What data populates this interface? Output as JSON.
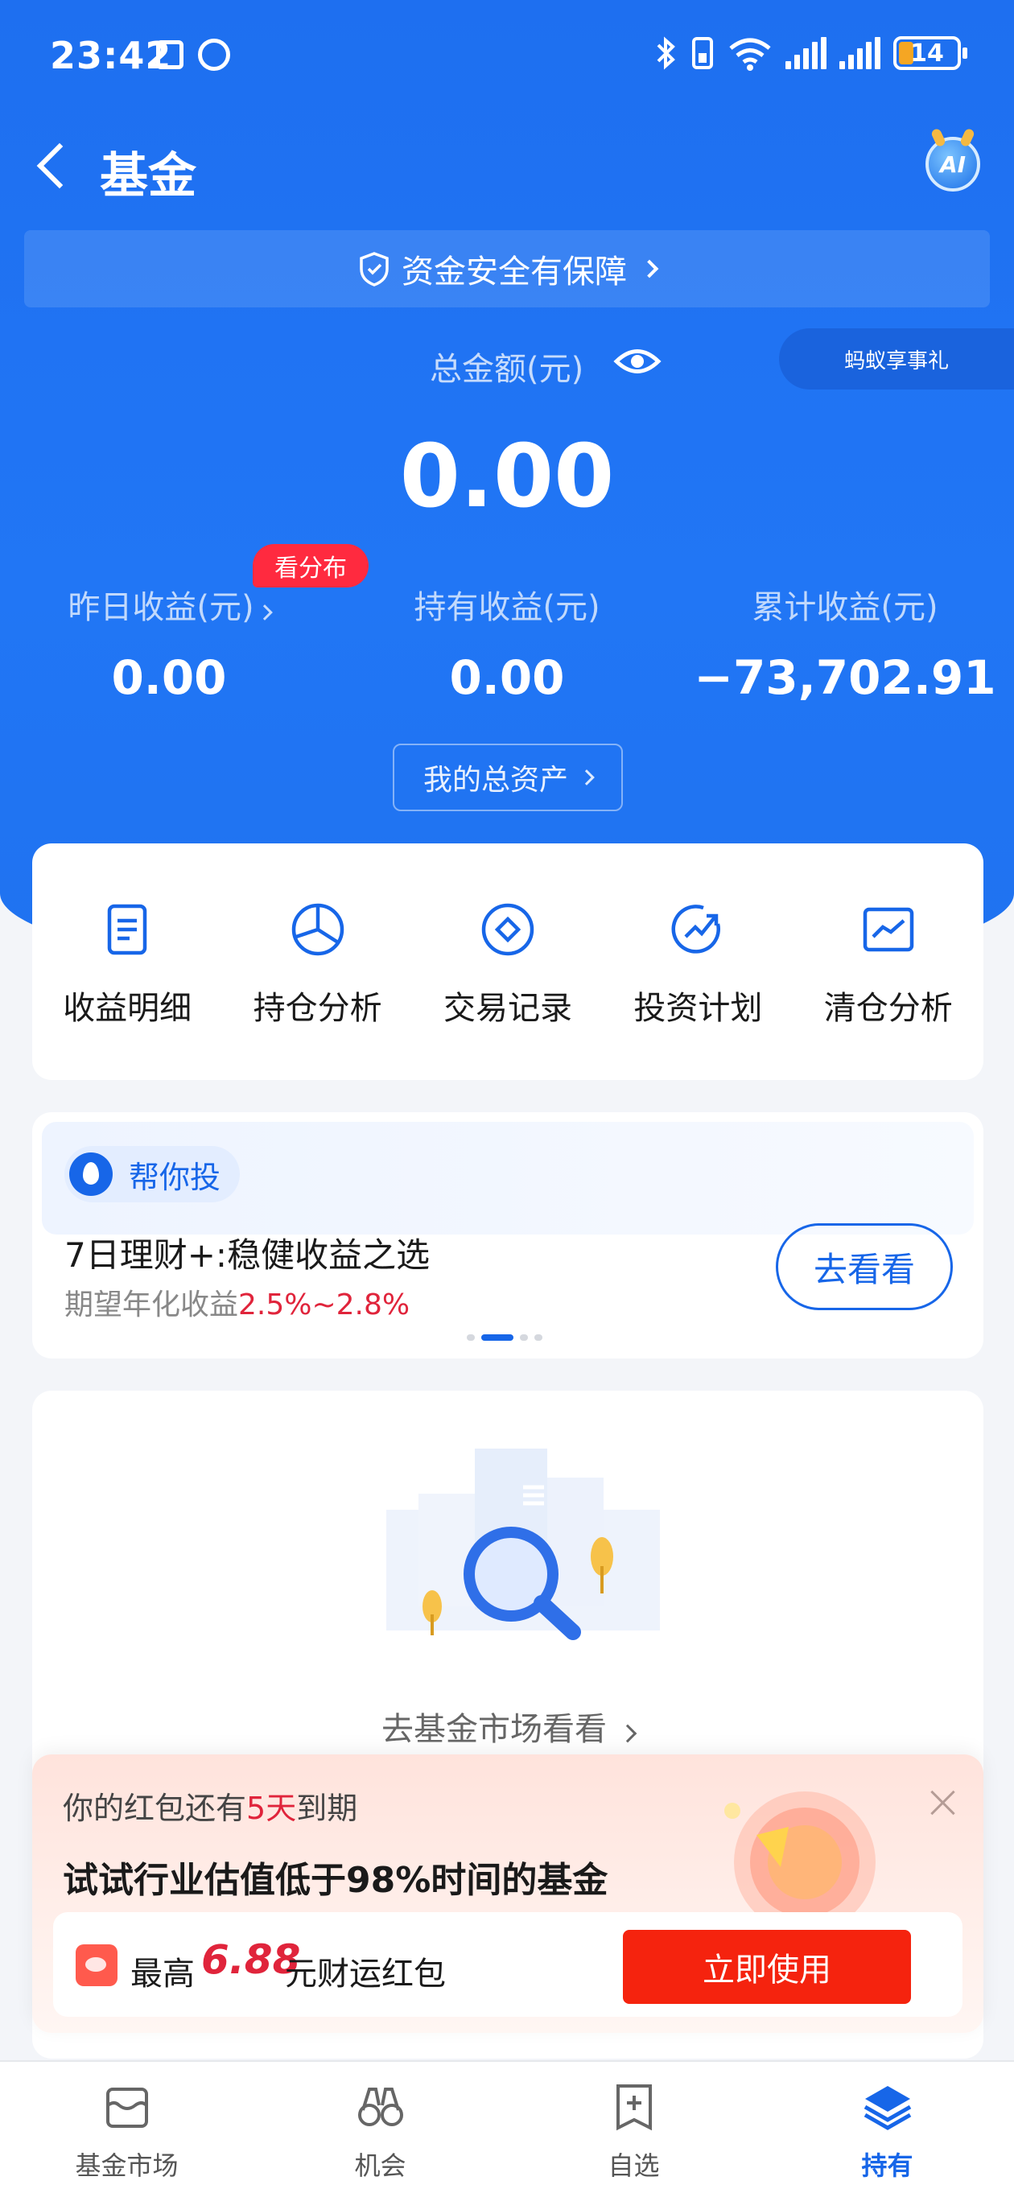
{
  "status_bar": {
    "time": "23:42",
    "battery": "14"
  },
  "header": {
    "title": "基金",
    "ai_label": "AI"
  },
  "safety_banner": {
    "text": "资金安全有保障"
  },
  "summary": {
    "total_label": "总金额(元)",
    "total_value": "0.00",
    "side_badge": "蚂蚁享事礼",
    "distribution_pill": "看分布",
    "metrics": [
      {
        "label": "昨日收益(元)",
        "value": "0.00"
      },
      {
        "label": "持有收益(元)",
        "value": "0.00"
      },
      {
        "label": "累计收益(元)",
        "value": "−73,702.91"
      }
    ],
    "assets_button": "我的总资产"
  },
  "features": [
    {
      "label": "收益明细",
      "icon": "document-icon"
    },
    {
      "label": "持仓分析",
      "icon": "pie-chart-icon"
    },
    {
      "label": "交易记录",
      "icon": "diamond-circle-icon"
    },
    {
      "label": "投资计划",
      "icon": "trend-up-icon"
    },
    {
      "label": "清仓分析",
      "icon": "line-chart-icon"
    }
  ],
  "help_card": {
    "tag": "帮你投",
    "headline": "7日理财+:稳健收益之选",
    "sub_prefix": "期望年化收益",
    "sub_rate": "2.5%~2.8%",
    "button": "去看看"
  },
  "empty_state": {
    "link": "去基金市场看看"
  },
  "promo": {
    "line1_prefix": "你的红包还有",
    "line1_days": "5天",
    "line1_suffix": "到期",
    "headline": "试试行业估值低于98%时间的基金",
    "amount_prefix": "最高",
    "amount": "6.88",
    "amount_suffix": "元财运红包",
    "button": "立即使用"
  },
  "bottom_nav": [
    {
      "label": "基金市场",
      "icon": "market-icon",
      "active": false
    },
    {
      "label": "机会",
      "icon": "binoculars-icon",
      "active": false
    },
    {
      "label": "自选",
      "icon": "add-bookmark-icon",
      "active": false
    },
    {
      "label": "持有",
      "icon": "layers-icon",
      "active": true
    }
  ],
  "colors": {
    "primary": "#1f72f0",
    "accent_blue": "#1766e8",
    "red": "#e0243b",
    "cta_red": "#f5230e"
  }
}
